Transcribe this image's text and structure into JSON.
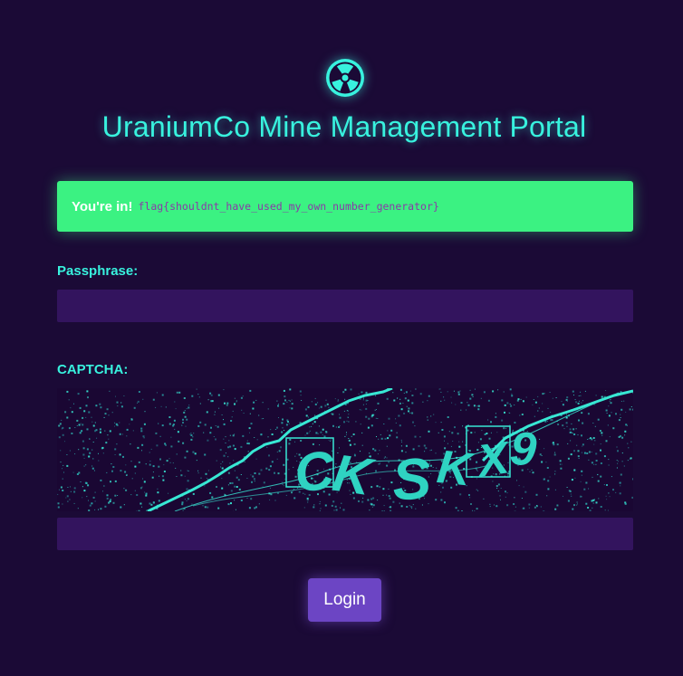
{
  "header": {
    "logo_icon": "radiation-icon",
    "title": "UraniumCo Mine Management Portal"
  },
  "alert": {
    "strong": "You're in!",
    "flag": "flag{shouldnt_have_used_my_own_number_generator}",
    "color": "#3bf282"
  },
  "form": {
    "passphrase_label": "Passphrase:",
    "passphrase_value": "",
    "captcha_label": "CAPTCHA:",
    "captcha_text": "CK SKX9",
    "captcha_value": "",
    "login_label": "Login"
  },
  "colors": {
    "background": "#1b0a36",
    "accent": "#38f2de",
    "input_bg": "#33145e",
    "button": "#6c45c4"
  }
}
